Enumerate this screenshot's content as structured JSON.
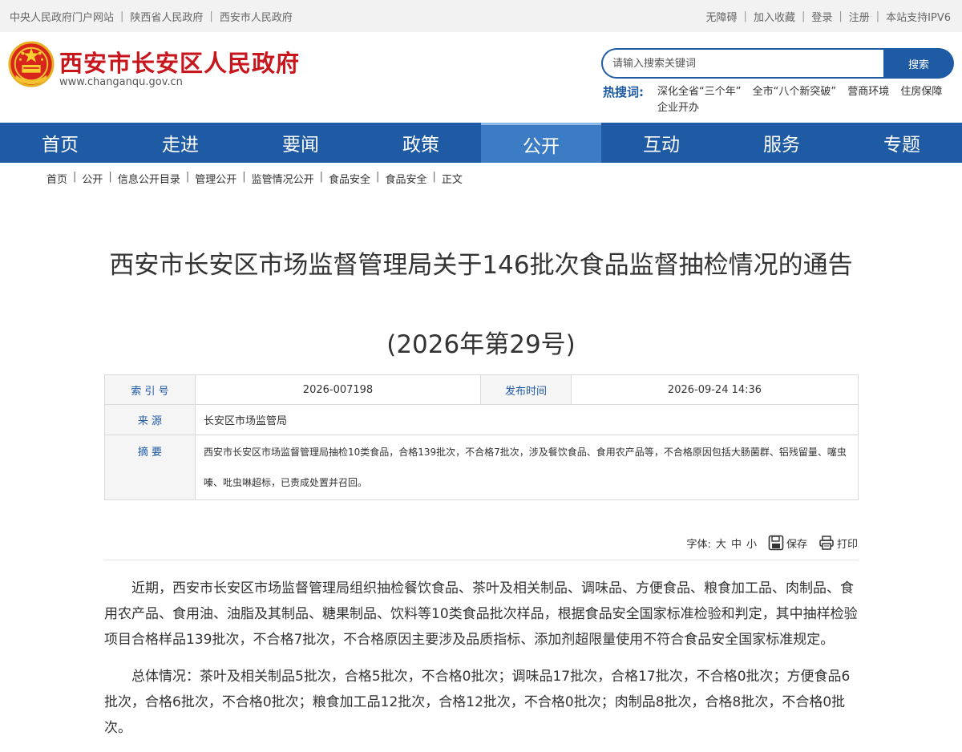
{
  "topbar": {
    "left_links": [
      "中央人民政府门户网站",
      "陕西省人民政府",
      "西安市人民政府"
    ],
    "right_links": [
      "无障碍",
      "加入收藏",
      "登录",
      "注册",
      "本站支持IPV6"
    ]
  },
  "header": {
    "site_title": "西安市长安区人民政府",
    "site_url": "www.changanqu.gov.cn",
    "search_placeholder": "请输入搜索关键词",
    "search_button": "搜索",
    "hot_label": "热搜词:",
    "hot_words": [
      "深化全省“三个年”",
      "全市“八个新突破”",
      "营商环境",
      "住房保障",
      "企业开办"
    ]
  },
  "nav": {
    "items": [
      "首页",
      "走进",
      "要闻",
      "政策",
      "公开",
      "互动",
      "服务",
      "专题"
    ],
    "active": "公开"
  },
  "breadcrumb": [
    "首页",
    "公开",
    "信息公开目录",
    "管理公开",
    "监管情况公开",
    "食品安全",
    "食品安全",
    "正文"
  ],
  "article": {
    "title": "西安市长安区市场监督管理局关于146批次食品监督抽检情况的通告",
    "subtitle": "(2026年第29号)",
    "meta": {
      "index_label": "索 引 号",
      "index_value": "2026-007198",
      "date_label": "发布时间",
      "date_value": "2026-09-24 14:36",
      "source_label": "来 源",
      "source_value": "长安区市场监管局",
      "summary_label": "摘 要",
      "summary_value": "西安市长安区市场监督管理局抽检10类食品，合格139批次，不合格7批次，涉及餐饮食品、食用农产品等，不合格原因包括大肠菌群、铝残留量、噻虫嗪、吡虫啉超标，已责成处置并召回。"
    },
    "tools": {
      "font_label": "字体:",
      "large": "大",
      "medium": "中",
      "small": "小",
      "save": "保存",
      "print": "打印"
    },
    "paragraphs": [
      "近期，西安市长安区市场监督管理局组织抽检餐饮食品、茶叶及相关制品、调味品、方便食品、粮食加工品、肉制品、食用农产品、食用油、油脂及其制品、糖果制品、饮料等10类食品批次样品，根据食品安全国家标准检验和判定，其中抽样检验项目合格样品139批次，不合格7批次，不合格原因主要涉及品质指标、添加剂超限量使用不符合食品安全国家标准规定。",
      "总体情况：茶叶及相关制品5批次，合格5批次，不合格0批次；调味品17批次，合格17批次，不合格0批次；方便食品6批次，合格6批次，不合格0批次；粮食加工品12批次，合格12批次，不合格0批次；肉制品8批次，合格8批次，不合格0批次。"
    ]
  },
  "colors": {
    "brand_red": "#c8161d",
    "brand_blue": "#1f5aa5",
    "nav_active": "#3b7cc4"
  }
}
